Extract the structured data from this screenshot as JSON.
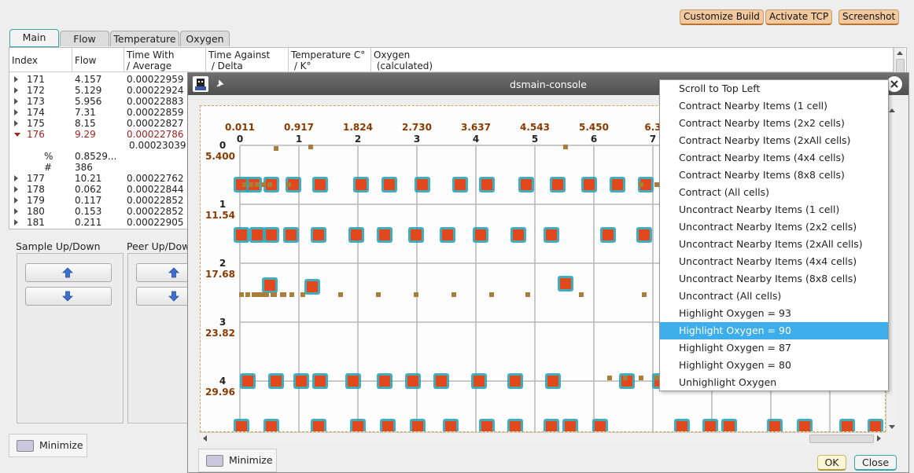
{
  "top_buttons": [
    "Customize Build",
    "Activate TCP",
    "Screenshot"
  ],
  "tabs": [
    "Main",
    "Flow",
    "Temperature",
    "Oxygen"
  ],
  "table": {
    "headers": [
      [
        "Index",
        ""
      ],
      [
        "Flow",
        ""
      ],
      [
        "Time With",
        "/ Average"
      ],
      [
        "Time Against",
        " / Delta"
      ],
      [
        "Temperature C°",
        " / K°"
      ],
      [
        "Oxygen",
        " (calculated)"
      ]
    ],
    "rows_before": [
      {
        "index": "171",
        "flow": "4.157",
        "time": "0.00022959"
      },
      {
        "index": "172",
        "flow": "5.129",
        "time": "0.00022924"
      },
      {
        "index": "173",
        "flow": "5.956",
        "time": "0.00022883"
      },
      {
        "index": "174",
        "flow": "7.31",
        "time": "0.00022859"
      },
      {
        "index": "175",
        "flow": "8.15",
        "time": "0.00022827"
      }
    ],
    "expanded_row": {
      "index": "176",
      "flow": "9.29",
      "time": "0.00022786",
      "avg": "0.00023039",
      "pct_label": "%",
      "pct_value": "0.8529...",
      "num_label": "#",
      "num_value": "386"
    },
    "rows_after": [
      {
        "index": "177",
        "flow": "10.21",
        "time": "0.00022762"
      },
      {
        "index": "178",
        "flow": "0.062",
        "time": "0.00022844"
      },
      {
        "index": "179",
        "flow": "0.117",
        "time": "0.00022852"
      },
      {
        "index": "180",
        "flow": "0.153",
        "time": "0.00022852"
      },
      {
        "index": "181",
        "flow": "0.211",
        "time": "0.00022905"
      }
    ]
  },
  "sample_group": {
    "label": "Sample Up/Down"
  },
  "peer_group": {
    "label": "Peer Up/Dow"
  },
  "minimize_label": "Minimize",
  "console": {
    "title": "dsmain-console",
    "x_values": [
      "0.011",
      "0.917",
      "1.824",
      "2.730",
      "3.637",
      "4.543",
      "5.450",
      "6.3"
    ],
    "x_indices": [
      "0",
      "1",
      "2",
      "3",
      "4",
      "5",
      "6",
      "7"
    ],
    "y_indices": [
      "0",
      "1",
      "2",
      "3",
      "4"
    ],
    "y_values": [
      "5.400",
      "11.54",
      "17.68",
      "23.82",
      "29.96"
    ],
    "ok_label": "OK",
    "close_label": "Close",
    "minimize_label": "Minimize"
  },
  "menu": {
    "items": [
      "Scroll to Top Left",
      "Contract Nearby Items (1 cell)",
      "Contract Nearby Items (2x2 cells)",
      "Contract Nearby Items (2xAll cells)",
      "Contract Nearby Items (4x4 cells)",
      "Contract Nearby Items (8x8 cells)",
      "Contract (All cells)",
      "Uncontract Nearby Items (1 cell)",
      "Uncontract Nearby Items (2x2 cells)",
      "Uncontract Nearby Items (2xAll cells)",
      "Uncontract Nearby Items (4x4 cells)",
      "Uncontract Nearby Items (8x8 cells)",
      "Uncontract (All cells)",
      "Highlight Oxygen = 93",
      "Highlight Oxygen = 90",
      "Highlight Oxygen = 87",
      "Highlight Oxygen = 80",
      "Unhighlight Oxygen"
    ],
    "selected": "Highlight Oxygen = 90"
  },
  "colors": {
    "accent": "#3daee9",
    "tab_active": "#3aa6a6",
    "marker_fill": "#e0481e",
    "marker_ring": "#2fa3b8",
    "axis_label": "#8a3a00"
  }
}
